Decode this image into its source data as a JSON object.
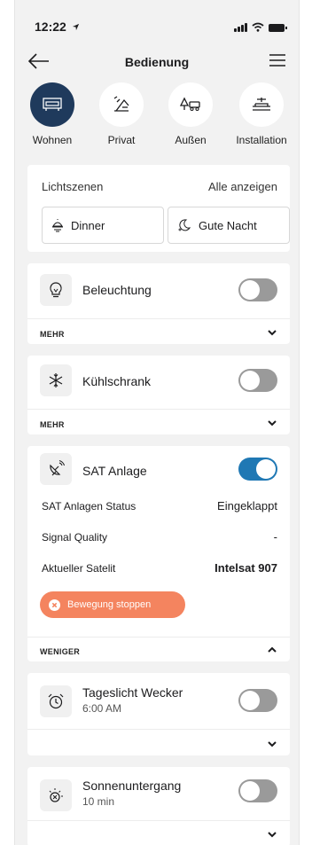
{
  "status_bar": {
    "time": "12:22"
  },
  "header": {
    "title": "Bedienung"
  },
  "categories": [
    {
      "label": "Wohnen",
      "icon": "living-room-icon",
      "active": true
    },
    {
      "label": "Privat",
      "icon": "private-room-icon",
      "active": false
    },
    {
      "label": "Außen",
      "icon": "outdoor-icon",
      "active": false
    },
    {
      "label": "Installation",
      "icon": "installation-icon",
      "active": false
    }
  ],
  "scenes": {
    "title": "Lichtszenen",
    "show_all": "Alle anzeigen",
    "items": [
      {
        "label": "Dinner",
        "icon": "dinner-icon"
      },
      {
        "label": "Gute Nacht",
        "icon": "moon-icon"
      }
    ]
  },
  "devices": {
    "beleuchtung": {
      "name": "Beleuchtung",
      "icon": "lightbulb-icon",
      "on": false,
      "footer": "MEHR"
    },
    "kuehlschrank": {
      "name": "Kühlschrank",
      "icon": "snowflake-icon",
      "on": false,
      "footer": "MEHR"
    },
    "sat": {
      "name": "SAT Anlage",
      "icon": "satellite-dish-icon",
      "on": true,
      "details": [
        {
          "label": "SAT Anlagen Status",
          "value": "Eingeklappt"
        },
        {
          "label": "Signal Quality",
          "value": "-"
        },
        {
          "label": "Aktueller Satelit",
          "value": "Intelsat 907"
        }
      ],
      "stop_button": "Bewegung stoppen",
      "footer": "WENIGER"
    },
    "wecker": {
      "name": "Tageslicht Wecker",
      "sub": "6:00 AM",
      "icon": "alarm-clock-icon",
      "on": false
    },
    "sonnenuntergang": {
      "name": "Sonnenuntergang",
      "sub": "10 min",
      "icon": "sunset-icon",
      "on": false
    }
  },
  "colors": {
    "accent": "#1f78b4",
    "active_category": "#1f3a5c",
    "stop_button": "#f4845f",
    "toggle_off": "#9a9a9a"
  }
}
